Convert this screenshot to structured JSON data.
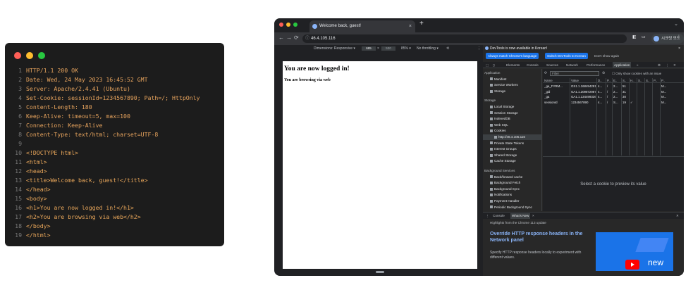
{
  "code_window": {
    "lines": [
      {
        "n": "1",
        "t": "HTTP/1.1 200 OK"
      },
      {
        "n": "2",
        "t": "Date: Wed, 24 May 2023 16:45:52 GMT"
      },
      {
        "n": "3",
        "t": "Server: Apache/2.4.41 (Ubuntu)"
      },
      {
        "n": "4",
        "t": "Set-Cookie: sessionId=1234567890; Path=/; HttpOnly"
      },
      {
        "n": "5",
        "t": "Content-Length: 180"
      },
      {
        "n": "6",
        "t": "Keep-Alive: timeout=5, max=100"
      },
      {
        "n": "7",
        "t": "Connection: Keep-Alive"
      },
      {
        "n": "8",
        "t": "Content-Type: text/html; charset=UTF-8"
      },
      {
        "n": "9",
        "t": ""
      },
      {
        "n": "10",
        "t": "<!DOCTYPE html>"
      },
      {
        "n": "11",
        "t": "<html>"
      },
      {
        "n": "12",
        "t": "<head>"
      },
      {
        "n": "13",
        "t": "<title>Welcome back, guest!</title>"
      },
      {
        "n": "14",
        "t": "</head>"
      },
      {
        "n": "15",
        "t": "<body>"
      },
      {
        "n": "16",
        "t": "<h1>You are now logged in!</h1>"
      },
      {
        "n": "17",
        "t": "<h2>You are browsing via web</h2>"
      },
      {
        "n": "18",
        "t": "</body>"
      },
      {
        "n": "19",
        "t": "</html>"
      }
    ],
    "colors": {
      "red": "#ff5f57",
      "yellow": "#febc2e",
      "green": "#28c840"
    }
  },
  "browser": {
    "tab_title": "Welcome back, guest!",
    "tab_close": "×",
    "new_tab": "+",
    "tab_menu": "⌄",
    "address": "46.4.105.116",
    "profile": "시크릿 모드",
    "nav": {
      "back": "←",
      "forward": "→",
      "reload": "⟳"
    },
    "device_bar": {
      "dimensions_label": "Dimensions: Responsive ▾",
      "width": "685",
      "times": "×",
      "height": "530",
      "zoom": "85% ▾",
      "throttle": "No throttling ▾"
    },
    "page": {
      "h1": "You are now logged in!",
      "h2": "You are browsing via web"
    }
  },
  "devtools": {
    "info_bar": "DevTools is now available in Korean!",
    "info_close": "×",
    "btn_match": "Always match Chrome's language",
    "btn_switch": "Switch DevTools to Korean",
    "dont_show": "Don't show again",
    "tabs": [
      "Elements",
      "Console",
      "Sources",
      "Network",
      "Performance",
      "Application",
      "»"
    ],
    "application": {
      "section_application": "Application",
      "app_items": [
        "Manifest",
        "Service Workers",
        "Storage"
      ],
      "section_storage": "Storage",
      "storage_items": [
        "Local Storage",
        "Session Storage",
        "IndexedDB",
        "Web SQL",
        "Cookies",
        "http://46.4.105.116",
        "Private State Tokens",
        "Interest Groups",
        "Shared Storage",
        "Cache Storage"
      ],
      "section_background": "Background Services",
      "bg_items": [
        "Back/forward cache",
        "Background Fetch",
        "Background Sync",
        "Notifications",
        "Payment Handler",
        "Periodic Background Sync"
      ]
    },
    "cookies": {
      "filter_placeholder": "Filter",
      "only_issue": "Only show cookies with an issue",
      "columns": [
        "Name",
        "Value",
        "D..",
        "P..",
        "E..",
        "S..",
        "H..",
        "S..",
        "S..",
        "P..",
        "P.."
      ],
      "rows": [
        [
          "_ga_FYRM...",
          "GS1.1.1684942918...",
          "4...",
          "/",
          "2...",
          "51",
          "",
          "",
          "",
          "",
          "M..."
        ],
        [
          "_gid",
          "GA1.1.2098729871...",
          "4...",
          "/",
          "2...",
          "31",
          "",
          "",
          "",
          "",
          "M..."
        ],
        [
          "_ga",
          "GA1.1.1344993363...",
          "4...",
          "/",
          "2...",
          "30",
          "",
          "",
          "",
          "",
          "M..."
        ],
        [
          "sessionId",
          "1234567890",
          "4...",
          "/",
          "S...",
          "19",
          "✓",
          "",
          "",
          "",
          "M..."
        ]
      ],
      "preview_text": "Select a cookie to preview its value"
    },
    "drawer": {
      "tabs": [
        "Console",
        "What's New"
      ],
      "close": "×",
      "highlights": "Highlights from the Chrome 113 update",
      "title": "Override HTTP response headers in the Network panel",
      "desc": "Specify HTTP response headers locally to experiment with different values.",
      "thumb_text": "new"
    }
  }
}
